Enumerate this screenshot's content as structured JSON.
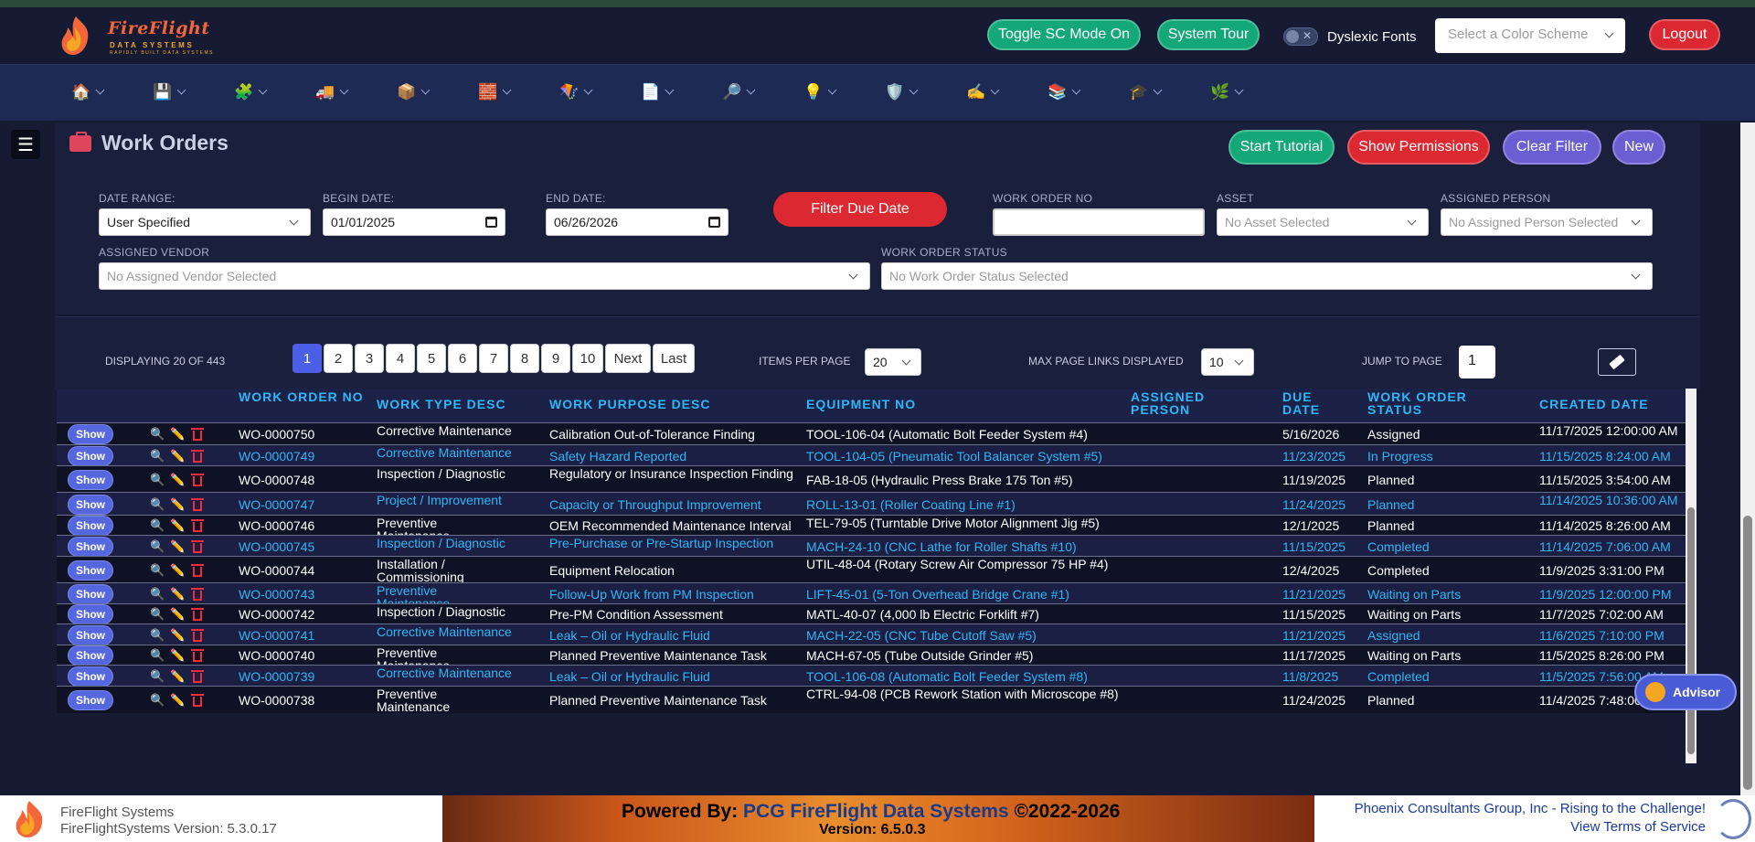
{
  "header": {
    "logo_brand": "FireFlight",
    "logo_sub": "DATA SYSTEMS",
    "logo_tag": "RAPIDLY BUILT DATA SYSTEMS",
    "toggle_sc": "Toggle SC Mode On",
    "system_tour": "System Tour",
    "dyslexic_toggle_x": "✕",
    "dyslexic_label": "Dyslexic Fonts",
    "color_scheme_placeholder": "Select a Color Scheme",
    "logout": "Logout"
  },
  "nav": {
    "icons": [
      "🏠",
      "💾",
      "🧩",
      "🚚",
      "📦",
      "🧱",
      "🪁",
      "📄",
      "🔎",
      "💡",
      "🛡️",
      "✍️",
      "📚",
      "🎓",
      "🌿"
    ]
  },
  "sidebar_toggle": "☰",
  "page": {
    "title": "Work Orders",
    "buttons": {
      "start_tutorial": "Start Tutorial",
      "show_permissions": "Show Permissions",
      "clear_filter": "Clear Filter",
      "new": "New"
    }
  },
  "filters": {
    "date_range_label": "DATE RANGE:",
    "date_range_value": "User Specified",
    "begin_date_label": "BEGIN DATE:",
    "begin_date_value": "01/01/2025",
    "end_date_label": "END DATE:",
    "end_date_value": "06/26/2026",
    "filter_due_date": "Filter Due Date",
    "work_order_no_label": "WORK ORDER NO",
    "asset_label": "ASSET",
    "asset_placeholder": "No Asset Selected",
    "assigned_person_label": "ASSIGNED PERSON",
    "assigned_person_placeholder": "No Assigned Person Selected",
    "assigned_vendor_label": "ASSIGNED VENDOR",
    "assigned_vendor_placeholder": "No Assigned Vendor Selected",
    "status_label": "WORK ORDER STATUS",
    "status_placeholder": "No Work Order Status Selected"
  },
  "pagination": {
    "displaying": "DISPLAYING 20 OF 443",
    "pages": [
      "1",
      "2",
      "3",
      "4",
      "5",
      "6",
      "7",
      "8",
      "9",
      "10"
    ],
    "next": "Next",
    "last": "Last",
    "items_per_page_label": "ITEMS PER PAGE",
    "items_per_page_value": "20",
    "max_links_label": "MAX PAGE LINKS DISPLAYED",
    "max_links_value": "10",
    "jump_label": "JUMP TO PAGE",
    "jump_value": "1"
  },
  "table": {
    "columns": [
      "WORK ORDER NO",
      "WORK TYPE DESC",
      "WORK PURPOSE DESC",
      "EQUIPMENT NO",
      "ASSIGNED PERSON",
      "DUE DATE",
      "WORK ORDER STATUS",
      "CREATED DATE"
    ],
    "show_label": "Show",
    "rows": [
      {
        "wo": "WO-0000750",
        "type": "Corrective Maintenance",
        "purpose": "Calibration Out-of-Tolerance Finding",
        "equip": "TOOL-106-04 (Automatic Bolt Feeder System #4)",
        "person": "",
        "due": "5/16/2026",
        "status": "Assigned",
        "created": "11/17/2025 12:00:00 AM"
      },
      {
        "wo": "WO-0000749",
        "type": "Corrective Maintenance",
        "purpose": "Safety Hazard Reported",
        "equip": "TOOL-104-05 (Pneumatic Tool Balancer System #5)",
        "person": "",
        "due": "11/23/2025",
        "status": "In Progress",
        "created": "11/15/2025 8:24:00 AM"
      },
      {
        "wo": "WO-0000748",
        "type": "Inspection / Diagnostic",
        "purpose": "Regulatory or Insurance Inspection Finding",
        "equip": "FAB-18-05 (Hydraulic Press Brake 175 Ton #5)",
        "person": "",
        "due": "11/19/2025",
        "status": "Planned",
        "created": "11/15/2025 3:54:00 AM"
      },
      {
        "wo": "WO-0000747",
        "type": "Project / Improvement",
        "purpose": "Capacity or Throughput Improvement",
        "equip": "ROLL-13-01 (Roller Coating Line #1)",
        "person": "",
        "due": "11/24/2025",
        "status": "Planned",
        "created": "11/14/2025 10:36:00 AM"
      },
      {
        "wo": "WO-0000746",
        "type": "Preventive Maintenance",
        "purpose": "OEM Recommended Maintenance Interval",
        "equip": "TEL-79-05 (Turntable Drive Motor Alignment Jig #5)",
        "person": "",
        "due": "12/1/2025",
        "status": "Planned",
        "created": "11/14/2025 8:26:00 AM"
      },
      {
        "wo": "WO-0000745",
        "type": "Inspection / Diagnostic",
        "purpose": "Pre-Purchase or Pre-Startup Inspection",
        "equip": "MACH-24-10 (CNC Lathe for Roller Shafts #10)",
        "person": "",
        "due": "11/15/2025",
        "status": "Completed",
        "created": "11/14/2025 7:06:00 AM"
      },
      {
        "wo": "WO-0000744",
        "type": "Installation / Commissioning",
        "purpose": "Equipment Relocation",
        "equip": "UTIL-48-04 (Rotary Screw Air Compressor 75 HP #4)",
        "person": "",
        "due": "12/4/2025",
        "status": "Completed",
        "created": "11/9/2025 3:31:00 PM"
      },
      {
        "wo": "WO-0000743",
        "type": "Preventive Maintenance",
        "purpose": "Follow-Up Work from PM Inspection",
        "equip": "LIFT-45-01 (5-Ton Overhead Bridge Crane #1)",
        "person": "",
        "due": "11/21/2025",
        "status": "Waiting on Parts",
        "created": "11/9/2025 12:00:00 PM"
      },
      {
        "wo": "WO-0000742",
        "type": "Inspection / Diagnostic",
        "purpose": "Pre-PM Condition Assessment",
        "equip": "MATL-40-07 (4,000 lb Electric Forklift #7)",
        "person": "",
        "due": "11/15/2025",
        "status": "Waiting on Parts",
        "created": "11/7/2025 7:02:00 AM"
      },
      {
        "wo": "WO-0000741",
        "type": "Corrective Maintenance",
        "purpose": "Leak – Oil or Hydraulic Fluid",
        "equip": "MACH-22-05 (CNC Tube Cutoff Saw #5)",
        "person": "",
        "due": "11/21/2025",
        "status": "Assigned",
        "created": "11/6/2025 7:10:00 PM"
      },
      {
        "wo": "WO-0000740",
        "type": "Preventive Maintenance",
        "purpose": "Planned Preventive Maintenance Task",
        "equip": "MACH-67-05 (Tube Outside Grinder #5)",
        "person": "",
        "due": "11/17/2025",
        "status": "Waiting on Parts",
        "created": "11/5/2025 8:26:00 PM"
      },
      {
        "wo": "WO-0000739",
        "type": "Corrective Maintenance",
        "purpose": "Leak – Oil or Hydraulic Fluid",
        "equip": "TOOL-106-08 (Automatic Bolt Feeder System #8)",
        "person": "",
        "due": "11/8/2025",
        "status": "Completed",
        "created": "11/5/2025 7:56:00 AM"
      },
      {
        "wo": "WO-0000738",
        "type": "Preventive Maintenance",
        "purpose": "Planned Preventive Maintenance Task",
        "equip": "CTRL-94-08 (PCB Rework Station with Microscope #8)",
        "person": "",
        "due": "11/24/2025",
        "status": "Planned",
        "created": "11/4/2025 7:48:00 AM"
      }
    ]
  },
  "advisor": "Advisor",
  "footer": {
    "company": "FireFlight Systems",
    "version_left": "FireFlightSystems Version: 5.3.0.17",
    "powered_by": "Powered By: ",
    "powered_name": "PCG FireFlight Data Systems",
    "powered_copy": " ©2022-2026",
    "version_center": "Version: 6.5.0.3",
    "right1": "Phoenix Consultants Group, Inc - Rising to the Challenge!",
    "right2": "View Terms of Service"
  }
}
